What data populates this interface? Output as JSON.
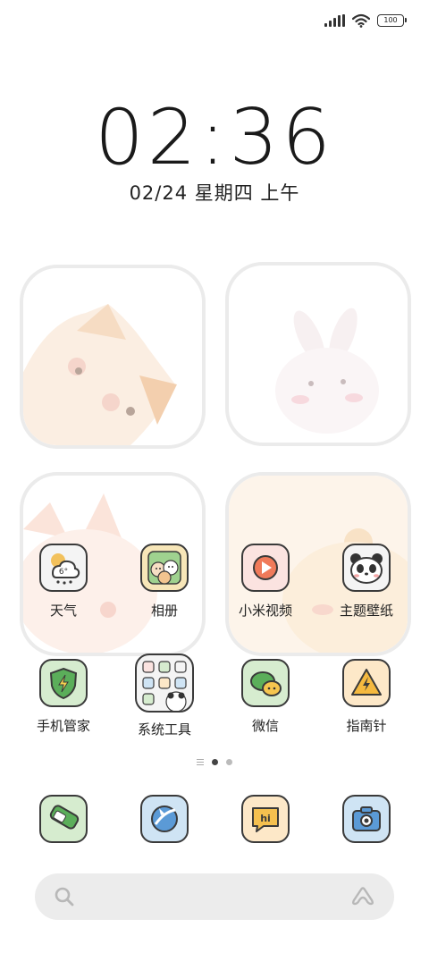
{
  "status_bar": {
    "battery_level": "100",
    "signal_icon": "cellular-signal-icon",
    "wifi_icon": "wifi-icon"
  },
  "lock": {
    "time": "02:36",
    "date": "02/24 星期四 上午"
  },
  "widgets": [
    {
      "name": "shiba-dog-widget",
      "tint": "#fbeee2"
    },
    {
      "name": "bunny-widget",
      "tint": "#fdf2f4"
    },
    {
      "name": "cat-widget",
      "tint": "#fdf0ea"
    },
    {
      "name": "hamster-widget",
      "tint": "#fdf0e0"
    }
  ],
  "apps_row1": [
    {
      "label": "天气",
      "icon": "weather-icon",
      "bg": "#f4f4f4"
    },
    {
      "label": "相册",
      "icon": "gallery-icon",
      "bg": "#f7e6b8"
    },
    {
      "label": "小米视频",
      "icon": "video-play-icon",
      "bg": "#fbe3e0"
    },
    {
      "label": "主题壁纸",
      "icon": "panda-themes-icon",
      "bg": "#f4f4f4"
    }
  ],
  "apps_row2": [
    {
      "label": "手机管家",
      "icon": "security-shield-icon",
      "bg": "#d6eccf"
    },
    {
      "label": "系统工具",
      "icon": "system-tools-folder-icon",
      "bg": "#f4f4f4"
    },
    {
      "label": "微信",
      "icon": "chat-bubble-icon",
      "bg": "#d6eccf"
    },
    {
      "label": "指南针",
      "icon": "compass-warning-icon",
      "bg": "#fde8c8"
    }
  ],
  "dock": [
    {
      "icon": "phone-icon",
      "bg": "#d6eccf"
    },
    {
      "icon": "browser-globe-icon",
      "bg": "#cfe4f4"
    },
    {
      "icon": "messages-hi-icon",
      "bg": "#fde8c8"
    },
    {
      "icon": "camera-icon",
      "bg": "#cfe4f4"
    }
  ],
  "page_indicator": {
    "pages": 2,
    "current": 1
  },
  "search": {
    "search_icon": "search-icon",
    "assistant_icon": "assistant-icon"
  },
  "colors": {
    "outline": "#3a3a3a",
    "frame": "#ebebeb",
    "search_bg": "#ececec"
  }
}
